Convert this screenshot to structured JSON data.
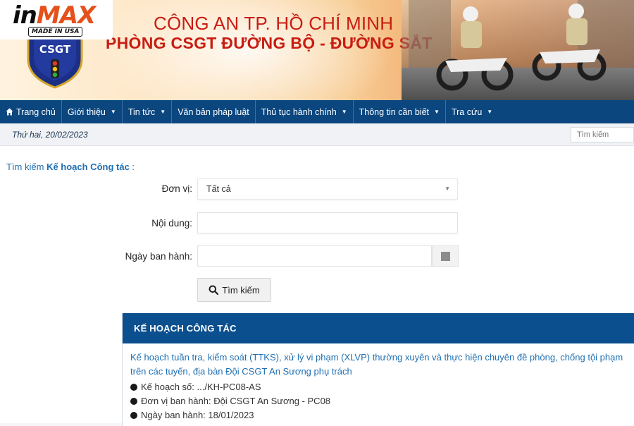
{
  "watermark": {
    "brand_prefix": "in",
    "brand_suffix": "MAX",
    "tagline": "MADE IN USA"
  },
  "header": {
    "logo_text": "CSGT",
    "title_line1": "CÔNG AN TP. HỒ CHÍ MINH",
    "title_line2": "PHÒNG CSGT ĐƯỜNG BỘ - ĐƯỜNG SẮT"
  },
  "nav": {
    "items": [
      {
        "label": "Trang chủ",
        "icon": "home-icon",
        "dropdown": false
      },
      {
        "label": "Giới thiệu",
        "dropdown": true
      },
      {
        "label": "Tin tức",
        "dropdown": true
      },
      {
        "label": "Văn bản pháp luật",
        "dropdown": false
      },
      {
        "label": "Thủ tục hành chính",
        "dropdown": true
      },
      {
        "label": "Thông tin cần biết",
        "dropdown": true
      },
      {
        "label": "Tra cứu",
        "dropdown": true
      }
    ]
  },
  "datebar": {
    "date": "Thứ hai, 20/02/2023",
    "search_placeholder": "Tìm kiếm"
  },
  "search_form": {
    "heading_prefix": "Tìm kiếm ",
    "heading_bold": "Kế hoạch Công tác",
    "heading_suffix": " :",
    "unit_label": "Đơn vị:",
    "unit_value": "Tất cả",
    "content_label": "Nội dung:",
    "content_value": "",
    "date_label": "Ngày ban hành:",
    "date_value": "",
    "search_button": "Tìm kiếm"
  },
  "results": {
    "heading": "KẾ HOẠCH CÔNG TÁC",
    "items": [
      {
        "title": "Kế hoạch tuần tra, kiểm soát (TTKS), xử lý vi phạm (XLVP) thường xuyên và thực hiện chuyên đề phòng, chống tội phạm trên các tuyến, địa bàn Đội CSGT An Sương phụ trách",
        "details": [
          "Kế hoạch số: .../KH-PC08-AS",
          "Đơn vị ban hành: Đội CSGT An Sương - PC08",
          "Ngày ban hành: 18/01/2023"
        ]
      }
    ]
  },
  "colors": {
    "nav_bg": "#0b467f",
    "panel_head_bg": "#0b4f8e",
    "title_red": "#c81d12",
    "link_blue": "#1f6fb1"
  }
}
